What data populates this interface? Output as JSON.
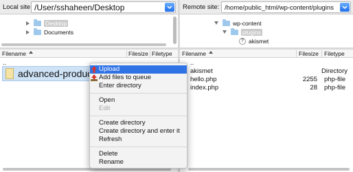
{
  "local": {
    "site_label": "Local site:",
    "path": "/User/sshaheen/Desktop",
    "tree": [
      {
        "label": "Desktop",
        "selected": true
      },
      {
        "label": "Documents",
        "selected": false
      }
    ],
    "columns": {
      "filename": "Filename",
      "filesize": "Filesize",
      "filetype": "Filetype"
    },
    "rows": [
      {
        "name": ".."
      }
    ],
    "selected_file": "advanced-product-fields-for-woocommerce"
  },
  "remote": {
    "site_label": "Remote site:",
    "path": "/home/public_html/wp-content/plugins",
    "tree": [
      {
        "label": "wp-content"
      },
      {
        "label": "plugins",
        "selected": true
      },
      {
        "label": "akismet"
      }
    ],
    "columns": {
      "filename": "Filename",
      "filesize": "Filesize",
      "filetype": "Filetype"
    },
    "rows": [
      {
        "name": "..",
        "size": "",
        "type": ""
      },
      {
        "name": "akismet",
        "size": "",
        "type": "Directory"
      },
      {
        "name": "hello.php",
        "size": "2255",
        "type": "php-file"
      },
      {
        "name": "index.php",
        "size": "28",
        "type": "php-file"
      }
    ]
  },
  "context_menu": {
    "items": [
      {
        "label": "Upload",
        "icon": "upload-arrow-icon"
      },
      {
        "label": "Add files to queue",
        "icon": "queue-arrow-icon"
      },
      {
        "label": "Enter directory"
      },
      {
        "label": "Open"
      },
      {
        "label": "Edit"
      },
      {
        "label": "Create directory"
      },
      {
        "label": "Create directory and enter it"
      },
      {
        "label": "Refresh"
      },
      {
        "label": "Delete"
      },
      {
        "label": "Rename"
      }
    ]
  },
  "colors": {
    "selection": "#2f72e6",
    "combo_arrow": "#1f6fea",
    "file_highlight": "#cfe3f7"
  }
}
